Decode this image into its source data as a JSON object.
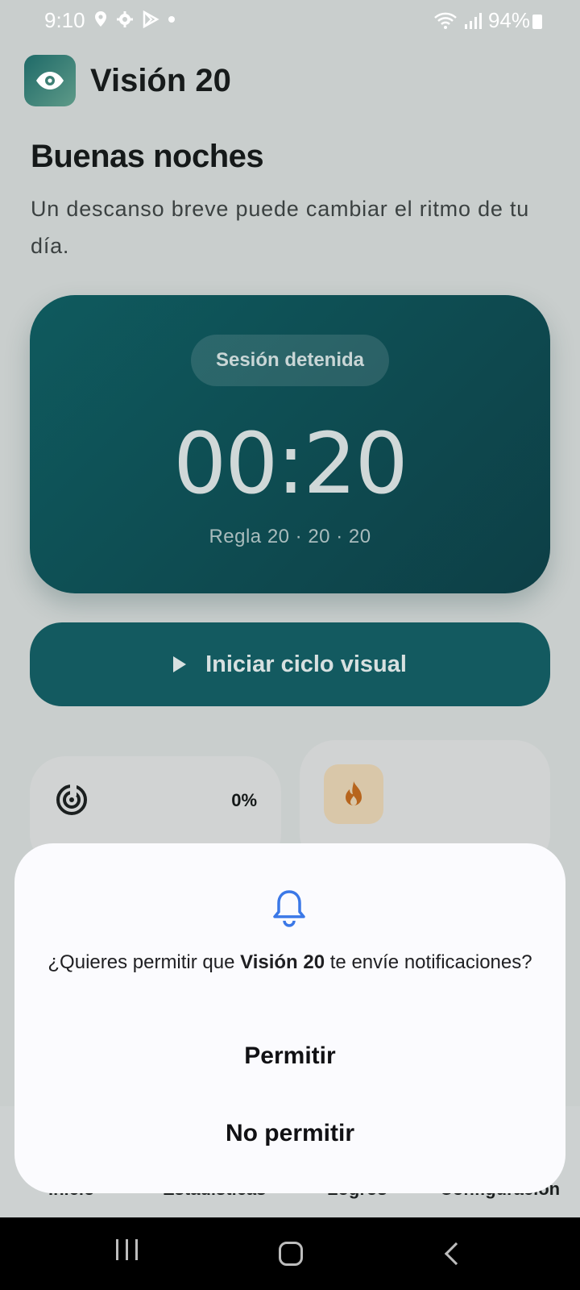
{
  "status_bar": {
    "time": "9:10",
    "battery": "94%"
  },
  "app": {
    "title": "Visión 20",
    "logo_icon": "eye-icon"
  },
  "home": {
    "greeting": "Buenas noches",
    "subtitle": "Un descanso breve puede cambiar el ritmo de tu día."
  },
  "timer": {
    "status": "Sesión detenida",
    "value": "00:20",
    "rule": "Regla 20 · 20 · 20"
  },
  "start_button": {
    "label": "Iniciar ciclo visual"
  },
  "stats": {
    "progress_percent": "0%",
    "progress_icon": "target-icon",
    "streak_icon": "flame-icon"
  },
  "bottom_nav": {
    "items": [
      "Inicio",
      "Estadísticas",
      "Logros",
      "Configuración"
    ]
  },
  "dialog": {
    "question_prefix": "¿Quieres permitir que ",
    "app_name": "Visión 20",
    "question_suffix": " te envíe notificaciones?",
    "allow_label": "Permitir",
    "deny_label": "No permitir",
    "icon": "bell-icon"
  },
  "colors": {
    "accent": "#135a60",
    "card": "#0f5a5e",
    "dialog_icon": "#3b78e7"
  }
}
